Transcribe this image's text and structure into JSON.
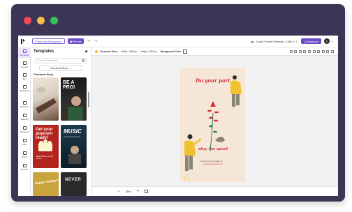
{
  "colors": {
    "frame": "#3d3556",
    "dot_red": "#ef4a55",
    "dot_yellow": "#f3c04a",
    "dot_green": "#35c25a",
    "accent": "#6a4bc8",
    "poster_bg": "#f6e6d8",
    "poster_heading": "#d32f3b"
  },
  "topbar": {
    "workspace_label": "Personal Workspace",
    "resize_label": "Resize",
    "doc_title": "Covid Social Distance - 1080 × 1",
    "download_label": "Download",
    "avatar_initial": "S"
  },
  "rail": {
    "items": [
      {
        "label": "Templates",
        "icon": "templates-icon"
      },
      {
        "label": "Images",
        "icon": "image-icon"
      },
      {
        "label": "Text",
        "icon": "text-icon"
      },
      {
        "label": "Illustrations",
        "icon": "illustration-icon"
      },
      {
        "label": "Mockups",
        "icon": "mockup-icon"
      },
      {
        "label": "Scientify",
        "icon": "scientify-icon"
      },
      {
        "label": "Elements",
        "icon": "elements-icon"
      },
      {
        "label": "Icons",
        "icon": "icons-icon"
      },
      {
        "label": "Brand",
        "icon": "brand-icon"
      },
      {
        "label": "My Files",
        "icon": "folder-icon"
      }
    ]
  },
  "panel": {
    "title": "Templates",
    "search_placeholder": "Search Templates",
    "category": "Facebook Story",
    "section_title": "Facebook Story",
    "thumbs": [
      {
        "text": ""
      },
      {
        "text": "BE A PRO!"
      },
      {
        "text": "Get your popcorn ready!"
      },
      {
        "text": "MUSIC"
      },
      {
        "text": "Happy Holidays"
      },
      {
        "text": "NEVER"
      }
    ],
    "thumb_sub": {
      "t3": "Best Movies of all times",
      "t4": "your favourite song"
    }
  },
  "editor": {
    "format_label": "Facebook Story",
    "width_label": "Width: 1080 px",
    "height_label": "Height: 1920 px",
    "bg_label": "Background Color"
  },
  "poster": {
    "heading": "Do your part",
    "subheading": "stay 1m apart",
    "footer_line1": "A social service message by",
    "footer_line2": "yourcompanyname.com"
  },
  "zoom": {
    "minus": "−",
    "level": "28%",
    "plus": "+"
  }
}
